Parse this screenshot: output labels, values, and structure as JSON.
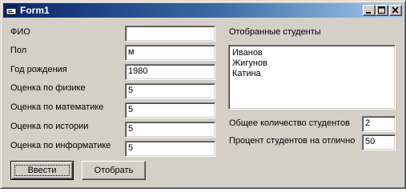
{
  "window": {
    "title": "Form1"
  },
  "form": {
    "fields": [
      {
        "label": "ФИО",
        "value": ""
      },
      {
        "label": "Пол",
        "value": "м"
      },
      {
        "label": "Год рождения",
        "value": "1980"
      },
      {
        "label": "Оценка по физике",
        "value": "5"
      },
      {
        "label": "Оценка по математике",
        "value": "5"
      },
      {
        "label": "Оценка по истории",
        "value": "5"
      },
      {
        "label": "Оценка по информатике",
        "value": "5"
      }
    ],
    "buttons": {
      "enter_label": "Ввести",
      "select_label": "Отобрать"
    }
  },
  "results": {
    "list_label": "Отобранные студенты",
    "students": [
      "Иванов",
      "Жигунов",
      "Катина"
    ],
    "total_label": "Общее количество студентов",
    "total_value": "2",
    "percent_label": "Процент студентов на отлично",
    "percent_value": "50"
  },
  "colors": {
    "face": "#d4d0c8",
    "title_start": "#0a246a",
    "title_end": "#a6caf0"
  },
  "icons": [
    "app-icon",
    "minimize-icon",
    "maximize-icon",
    "close-icon"
  ]
}
